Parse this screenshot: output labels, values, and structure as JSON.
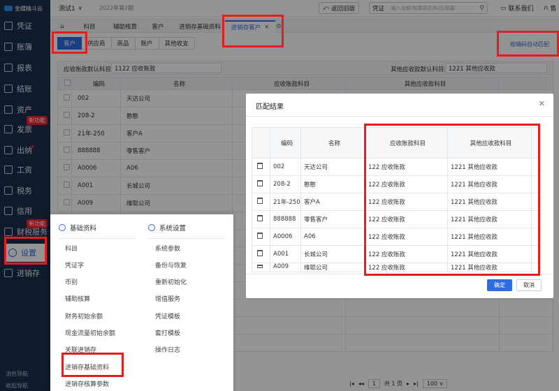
{
  "app": {
    "logo_text": "金蝶精斗云",
    "company": "测试1",
    "period": "2022年第2期"
  },
  "header": {
    "back_old_label": "返回旧版",
    "search_label": "凭证",
    "search_placeholder": "输入金额/核算项目/科目/摘要",
    "contact_label": "联系我们",
    "right_label": "售"
  },
  "sidebar": {
    "items": [
      {
        "label": "凭证",
        "icon": "voucher-icon"
      },
      {
        "label": "账簿",
        "icon": "ledger-icon"
      },
      {
        "label": "报表",
        "icon": "report-icon"
      },
      {
        "label": "结账",
        "icon": "close-account-icon"
      },
      {
        "label": "资产",
        "icon": "asset-icon"
      },
      {
        "label": "发票",
        "icon": "invoice-icon",
        "badge": "新功能"
      },
      {
        "label": "出纳",
        "icon": "cashier-icon"
      },
      {
        "label": "工资",
        "icon": "salary-icon"
      },
      {
        "label": "税务",
        "icon": "tax-icon"
      },
      {
        "label": "信用",
        "icon": "credit-icon"
      },
      {
        "label": "财税服务",
        "icon": "service-icon",
        "badge": "新功能"
      },
      {
        "label": "设置",
        "icon": "settings-icon"
      },
      {
        "label": "进销存",
        "icon": "inventory-icon"
      }
    ],
    "bottom": [
      "流色导航",
      "收起导航"
    ]
  },
  "tabs": [
    "科目",
    "辅助核算",
    "客户",
    "进销存基础资料",
    "进销存客户"
  ],
  "sub_tabs": [
    "客户",
    "供应商",
    "商品",
    "账户",
    "其他收支"
  ],
  "auto_match_label": "按编码自动匹配",
  "defaults": {
    "ar_label": "应收账款默认科目:",
    "ar_value": "1122 应收账款",
    "other_label": "其他应收款默认科目:",
    "other_value": "1221 其他应收款"
  },
  "main_table": {
    "headers": [
      "编码",
      "名称",
      "应收账款科目",
      "其他应收款科目"
    ],
    "rows": [
      [
        "002",
        "天达公司"
      ],
      [
        "208-2",
        "憨憨"
      ],
      [
        "21年-250",
        "客户A"
      ],
      [
        "888888",
        "零售客户"
      ],
      [
        "A0006",
        "A06"
      ],
      [
        "A001",
        "长城公司"
      ],
      [
        "A009",
        "维聪公司"
      ]
    ]
  },
  "pager": {
    "page": "1",
    "total": "共 1 页",
    "size": "100"
  },
  "settings_menu": {
    "col1_title": "基础资料",
    "col1": [
      "科目",
      "凭证字",
      "币别",
      "辅助核算",
      "财务初始余额",
      "现金流量初始余额",
      "关联进销存",
      "进销存基础资料",
      "进销存核算参数"
    ],
    "col2_title": "系统设置",
    "col2": [
      "系统参数",
      "备份与恢复",
      "重新初始化",
      "增值服务",
      "凭证模板",
      "套打模板",
      "操作日志"
    ]
  },
  "dialog": {
    "title": "匹配结果",
    "headers": [
      "编码",
      "名称",
      "应收账款科目",
      "其他应收款科目"
    ],
    "rows": [
      [
        "002",
        "天达公司",
        "122 应收账款",
        "1221 其他应收款"
      ],
      [
        "208-2",
        "憨憨",
        "122 应收账款",
        "1221 其他应收款"
      ],
      [
        "21年-250",
        "客户A",
        "122 应收账款",
        "1221 其他应收款"
      ],
      [
        "888888",
        "零售客户",
        "122 应收账款",
        "1221 其他应收款"
      ],
      [
        "A0006",
        "A06",
        "122 应收账款",
        "1221 其他应收款"
      ],
      [
        "A001",
        "长城公司",
        "122 应收账款",
        "1221 其他应收款"
      ],
      [
        "A009",
        "维聪公司",
        "122 应收账款",
        "1221 其他应收款"
      ]
    ],
    "ok_label": "确定",
    "cancel_label": "取消"
  }
}
